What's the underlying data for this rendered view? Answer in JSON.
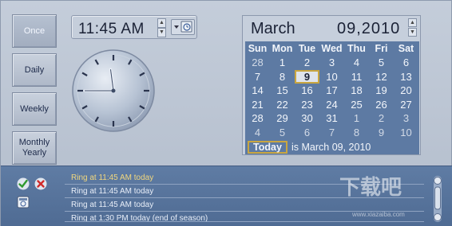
{
  "schedule_buttons": [
    "Once",
    "Daily",
    "Weekly",
    "Monthly Yearly"
  ],
  "time": {
    "value": "11:45 AM"
  },
  "clock": {
    "hour": 11,
    "minute": 45
  },
  "calendar": {
    "month": "March",
    "day_year": "09,2010",
    "weekdays": [
      "Sun",
      "Mon",
      "Tue",
      "Wed",
      "Thu",
      "Fri",
      "Sat"
    ],
    "weeks": [
      [
        "28",
        "1",
        "2",
        "3",
        "4",
        "5",
        "6"
      ],
      [
        "7",
        "8",
        "9",
        "10",
        "11",
        "12",
        "13"
      ],
      [
        "14",
        "15",
        "16",
        "17",
        "18",
        "19",
        "20"
      ],
      [
        "21",
        "22",
        "23",
        "24",
        "25",
        "26",
        "27"
      ],
      [
        "28",
        "29",
        "30",
        "31",
        "1",
        "2",
        "3"
      ],
      [
        "4",
        "5",
        "6",
        "7",
        "8",
        "9",
        "10"
      ]
    ],
    "selected": "9",
    "today_button": "Today",
    "today_text": "is March 09, 2010"
  },
  "alarms": [
    "Ring at 11:45 AM today",
    "Ring at 11:45 AM today",
    "Ring at 11:45 AM today",
    "Ring at 1:30 PM today (end of season)"
  ],
  "watermark": {
    "title": "下载吧",
    "url": "www.xiazaiba.com"
  },
  "colors": {
    "accent": "#5d7aa3",
    "highlight": "#c9a640",
    "panel": "#c4cdda"
  }
}
